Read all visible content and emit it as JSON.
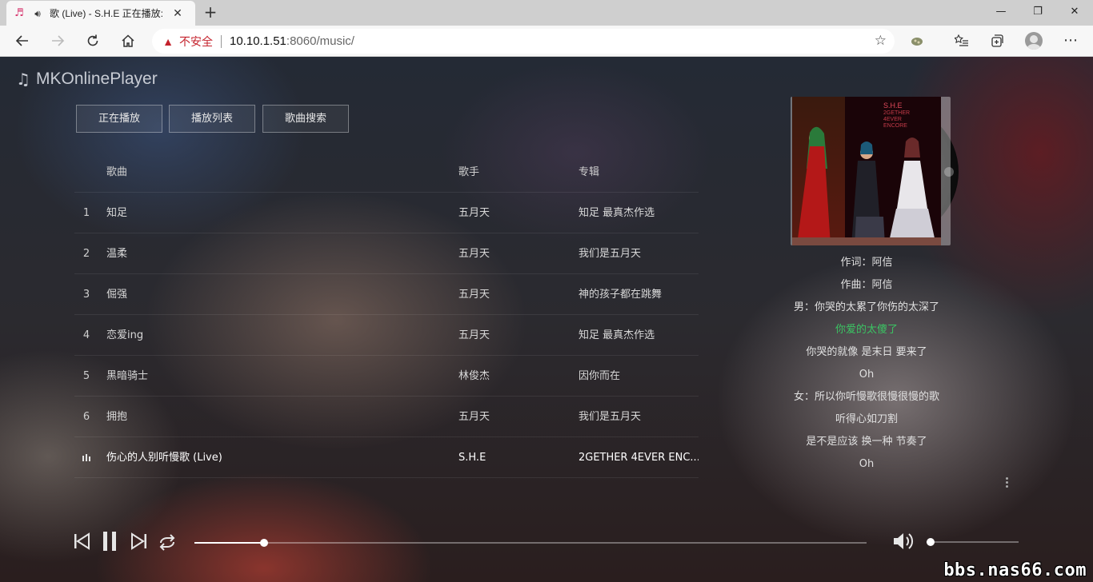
{
  "browser": {
    "tab_title": "歌 (Live) - S.H.E 正在播放: 伤",
    "close_label": "✕",
    "new_tab_label": "+",
    "address": {
      "security_label": "不安全",
      "url_host": "10.10.1.51",
      "url_rest": ":8060/music/"
    },
    "window_controls": {
      "minimize": "—",
      "maximize": "❐",
      "close": "✕"
    }
  },
  "app": {
    "logo_text": "MKOnlinePlayer",
    "nav_tabs": [
      {
        "label": "正在播放"
      },
      {
        "label": "播放列表"
      },
      {
        "label": "歌曲搜索"
      }
    ],
    "list_header": {
      "song": "歌曲",
      "artist": "歌手",
      "album": "专辑"
    },
    "songs": [
      {
        "num": "1",
        "title": "知足",
        "artist": "五月天",
        "album": "知足 最真杰作选"
      },
      {
        "num": "2",
        "title": "温柔",
        "artist": "五月天",
        "album": "我们是五月天"
      },
      {
        "num": "3",
        "title": "倔强",
        "artist": "五月天",
        "album": "神的孩子都在跳舞"
      },
      {
        "num": "4",
        "title": "恋爱ing",
        "artist": "五月天",
        "album": "知足 最真杰作选"
      },
      {
        "num": "5",
        "title": "黑暗骑士",
        "artist": "林俊杰",
        "album": "因你而在"
      },
      {
        "num": "6",
        "title": "拥抱",
        "artist": "五月天",
        "album": "我们是五月天"
      },
      {
        "num": "",
        "title": "伤心的人别听慢歌 (Live)",
        "artist": "S.H.E",
        "album": "2GETHER 4EVER ENC..."
      }
    ],
    "cover": {
      "brand": "S.H.E",
      "subtitle_lines": [
        "2GETHER",
        "4EVER",
        "ENCORE"
      ]
    },
    "lyrics": [
      {
        "text": "作词：阿信",
        "current": false
      },
      {
        "text": "作曲：阿信",
        "current": false
      },
      {
        "text": "男：你哭的太累了你伤的太深了",
        "current": false
      },
      {
        "text": "你爱的太傻了",
        "current": true
      },
      {
        "text": "你哭的就像 是末日 要来了",
        "current": false
      },
      {
        "text": "Oh",
        "current": false
      },
      {
        "text": "女：所以你听慢歌很慢很慢的歌",
        "current": false
      },
      {
        "text": "听得心如刀割",
        "current": false
      },
      {
        "text": "是不是应该 换一种 节奏了",
        "current": false
      },
      {
        "text": "Oh",
        "current": false
      }
    ],
    "player": {
      "progress": 0.103,
      "volume": 0.04
    },
    "colors": {
      "lyric_highlight": "#3bc463",
      "accent_warning": "#c4222c"
    }
  },
  "watermark": "bbs.nas66.com"
}
